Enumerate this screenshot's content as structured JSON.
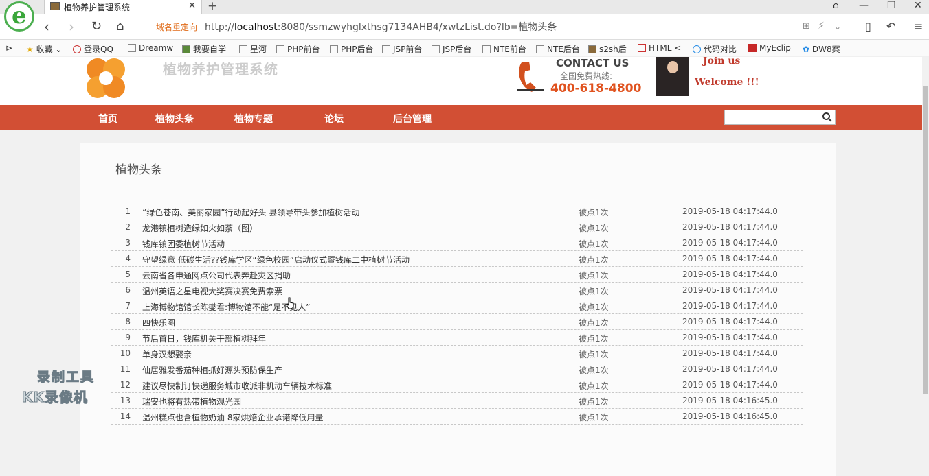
{
  "browser": {
    "tab_title": "植物养护管理系统",
    "redirect_label": "域名重定向",
    "url_prefix": "http://",
    "url_host": "localhost",
    "url_rest": ":8080/ssmzwyhglxthsg7134AHB4/xwtzList.do?lb=植物头条",
    "bookmarks": [
      "收藏",
      "登录QQ",
      "Dreamw",
      "我要自学",
      "星河",
      "PHP前台",
      "PHP后台",
      "JSP前台",
      "JSP后台",
      "NTE前台",
      "NTE后台",
      "s2sh后",
      "HTML <",
      "代码对比",
      "MyEclip",
      "DW8案"
    ]
  },
  "header": {
    "site_title": "植物养护管理系统",
    "contact_title": "CONTACT US",
    "hotline_label": "全国免费热线:",
    "hotline": "400-618-4800",
    "join_us": "Join us",
    "welcome": "Welcome !!!"
  },
  "nav": {
    "items": [
      "首页",
      "植物头条",
      "植物专题",
      "论坛",
      "后台管理"
    ],
    "search_placeholder": ""
  },
  "section_title": "植物头条",
  "news": [
    {
      "idx": "1",
      "title": "“绿色苍南、美丽家园”行动起好头 县领导带头参加植树活动",
      "clicks": "被点1次",
      "date": "2019-05-18 04:17:44.0"
    },
    {
      "idx": "2",
      "title": "龙港镇植树造绿如火如荼（图）",
      "clicks": "被点1次",
      "date": "2019-05-18 04:17:44.0"
    },
    {
      "idx": "3",
      "title": "钱库镇团委植树节活动",
      "clicks": "被点1次",
      "date": "2019-05-18 04:17:44.0"
    },
    {
      "idx": "4",
      "title": "守望绿意 低碳生活??钱库学区“绿色校园”启动仪式暨钱库二中植树节活动",
      "clicks": "被点1次",
      "date": "2019-05-18 04:17:44.0"
    },
    {
      "idx": "5",
      "title": "云南省各申通网点公司代表奔赴灾区捐助",
      "clicks": "被点1次",
      "date": "2019-05-18 04:17:44.0"
    },
    {
      "idx": "6",
      "title": "温州英语之星电视大奖赛决赛免费索票",
      "clicks": "被点1次",
      "date": "2019-05-18 04:17:44.0"
    },
    {
      "idx": "7",
      "title": "上海博物馆馆长陈燮君:博物馆不能“足不见人”",
      "clicks": "被点1次",
      "date": "2019-05-18 04:17:44.0"
    },
    {
      "idx": "8",
      "title": "四快乐图",
      "clicks": "被点1次",
      "date": "2019-05-18 04:17:44.0"
    },
    {
      "idx": "9",
      "title": "节后首日，钱库机关干部植树拜年",
      "clicks": "被点1次",
      "date": "2019-05-18 04:17:44.0"
    },
    {
      "idx": "10",
      "title": "单身汉想娶亲",
      "clicks": "被点1次",
      "date": "2019-05-18 04:17:44.0"
    },
    {
      "idx": "11",
      "title": "仙居雅发番茄种植抓好源头预防保生产",
      "clicks": "被点1次",
      "date": "2019-05-18 04:17:44.0"
    },
    {
      "idx": "12",
      "title": "建议尽快制订快递服务城市收派非机动车辆技术标准",
      "clicks": "被点1次",
      "date": "2019-05-18 04:17:44.0"
    },
    {
      "idx": "13",
      "title": "瑞安也将有热带植物观光园",
      "clicks": "被点1次",
      "date": "2019-05-18 04:16:45.0"
    },
    {
      "idx": "14",
      "title": "温州糕点也含植物奶油 8家烘焙企业承诺降低用量",
      "clicks": "被点1次",
      "date": "2019-05-18 04:16:45.0"
    }
  ],
  "watermark": {
    "line1": "录制工具",
    "line2": "KK录像机"
  },
  "colors": {
    "nav_bg": "#d24f34",
    "hotline": "#e0521e",
    "redirect": "#e06c1a"
  }
}
